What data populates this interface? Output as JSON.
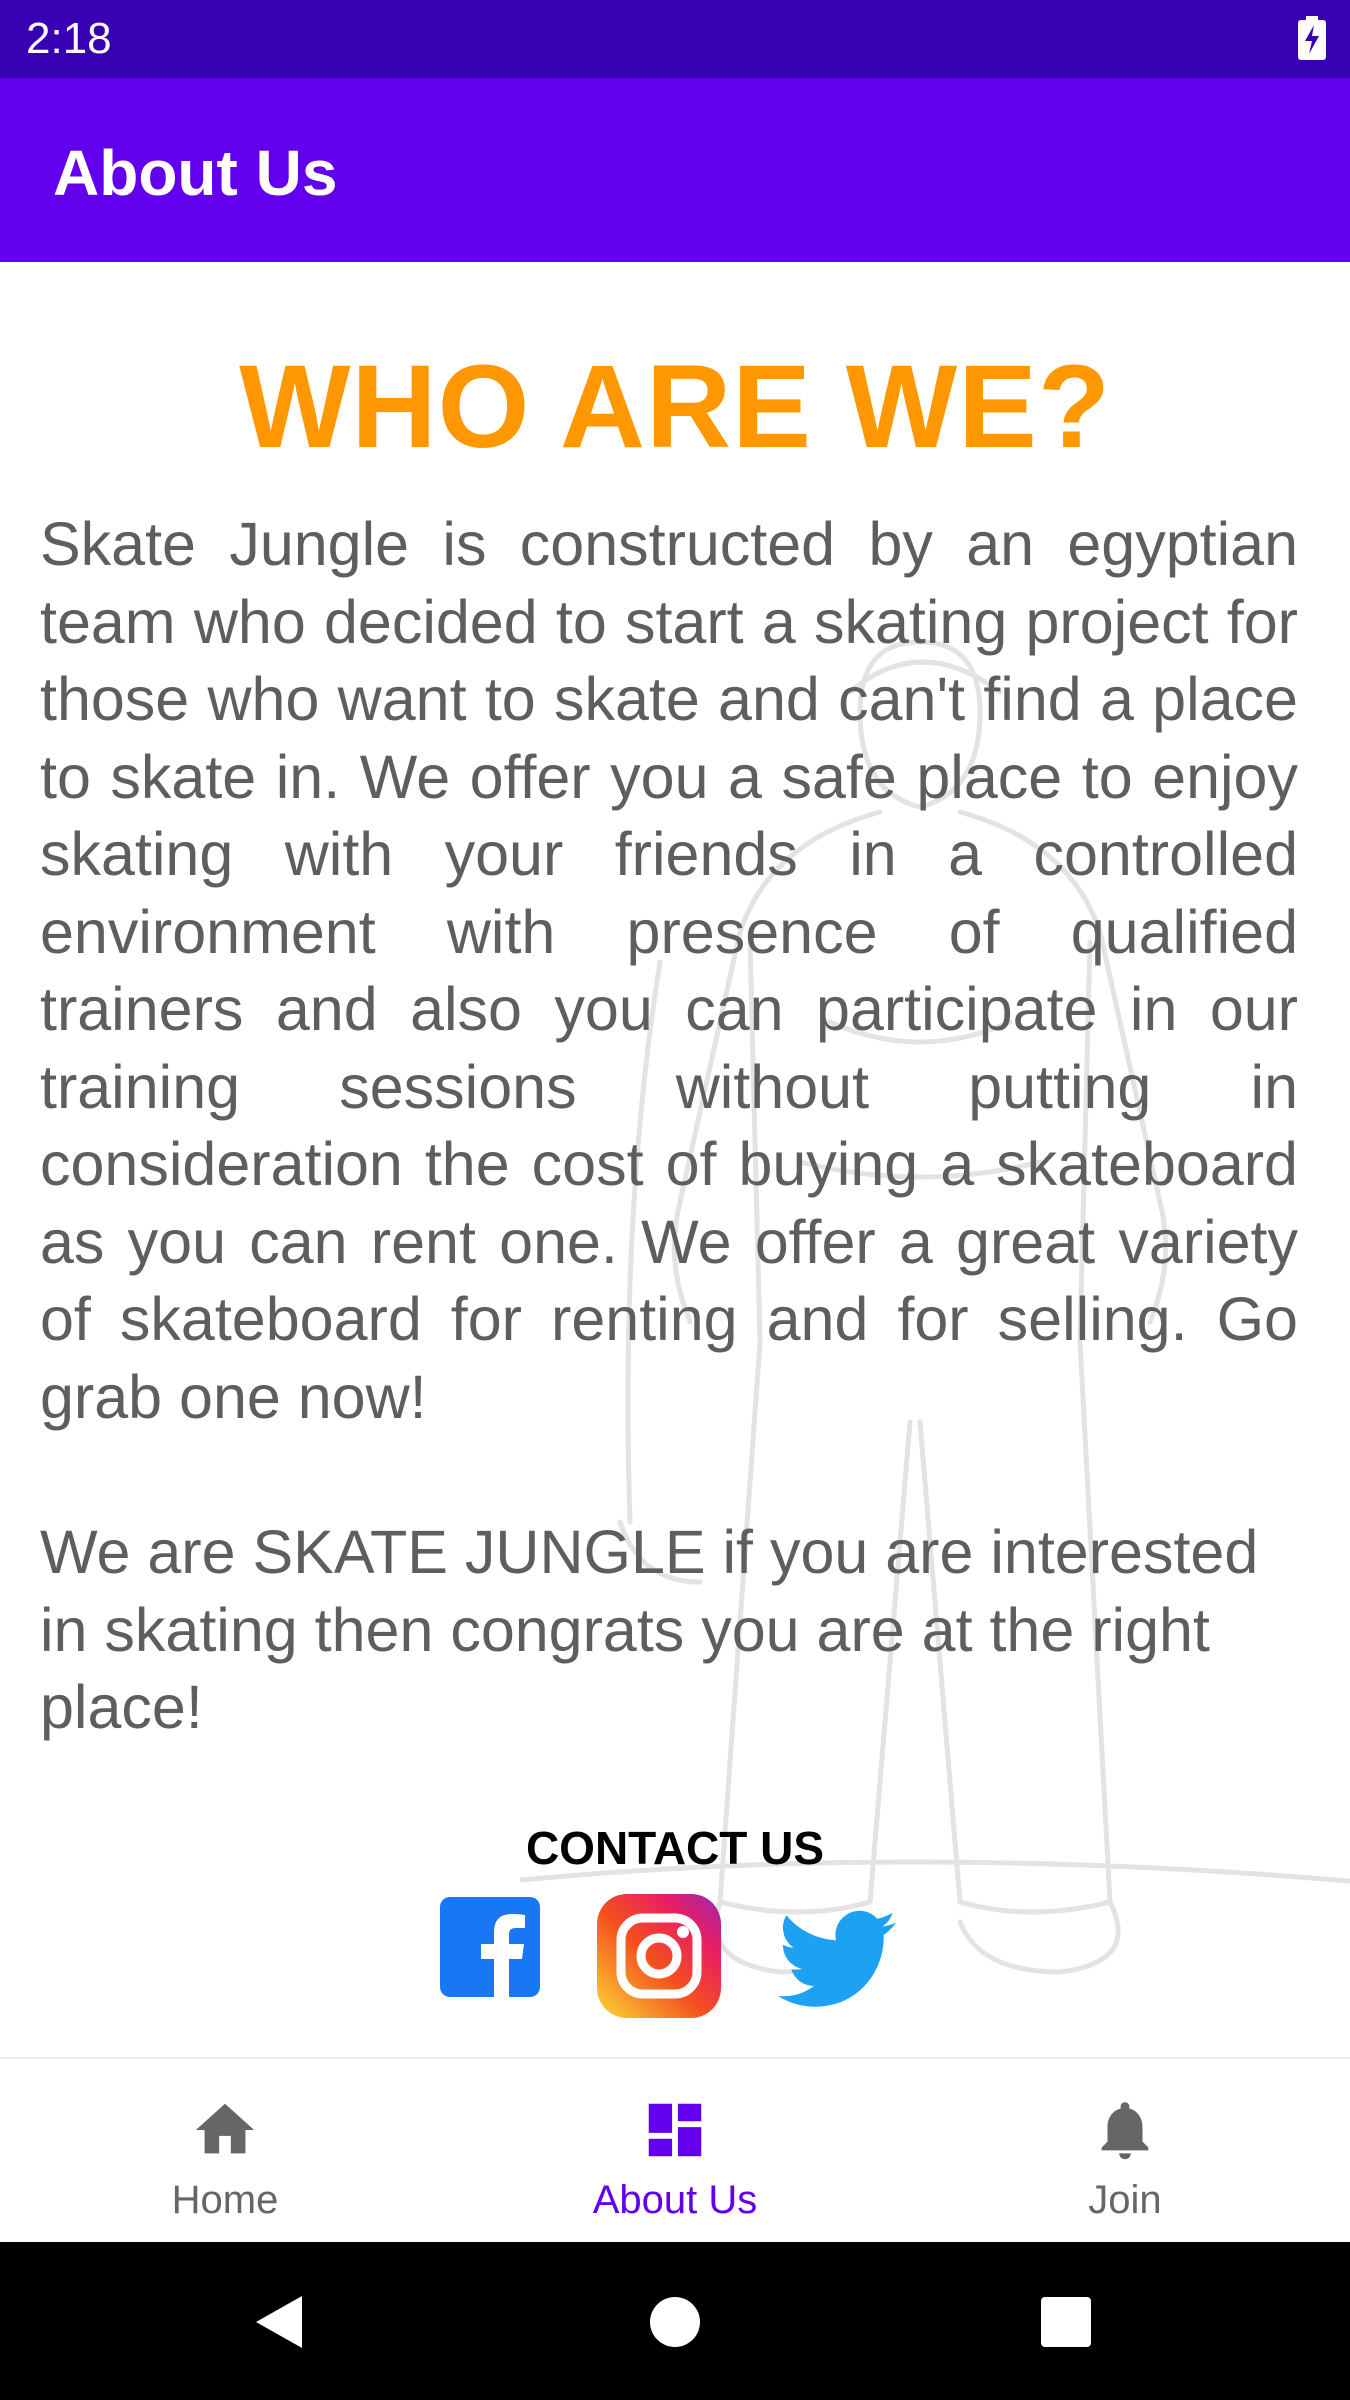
{
  "status_bar": {
    "time": "2:18",
    "battery_icon": "battery-charging-icon"
  },
  "app_bar": {
    "title": "About Us"
  },
  "content": {
    "headline": "WHO ARE WE?",
    "paragraph_1": "Skate Jungle is constructed by an egyptian team who decided to start a skating project for those who want to skate and can't find a place to skate in. We offer you a safe place to enjoy skating with your friends in a controlled environment with presence of qualified trainers and also you can participate in our training sessions without putting in consideration the cost of buying a skateboard as you can rent one. We offer a great variety of skateboard for renting and for selling. Go grab one now!",
    "paragraph_2": "We are SKATE JUNGLE if you are interested in skating then congrats you are at the right place!",
    "contact_title": "CONTACT US",
    "social_icons": [
      "facebook-icon",
      "instagram-icon",
      "twitter-icon"
    ],
    "colors": {
      "headline": "#ff9800",
      "body_text": "#5e5e5e"
    }
  },
  "bottom_nav": {
    "items": [
      {
        "label": "Home",
        "icon": "home-icon",
        "active": false
      },
      {
        "label": "About Us",
        "icon": "dashboard-icon",
        "active": true
      },
      {
        "label": "Join",
        "icon": "bell-icon",
        "active": false
      }
    ]
  },
  "system_nav": {
    "icons": [
      "back-icon",
      "home-circle-icon",
      "recents-icon"
    ]
  },
  "colors": {
    "status_bar": "#3700b3",
    "primary": "#6200ee",
    "accent": "#ff9800"
  }
}
